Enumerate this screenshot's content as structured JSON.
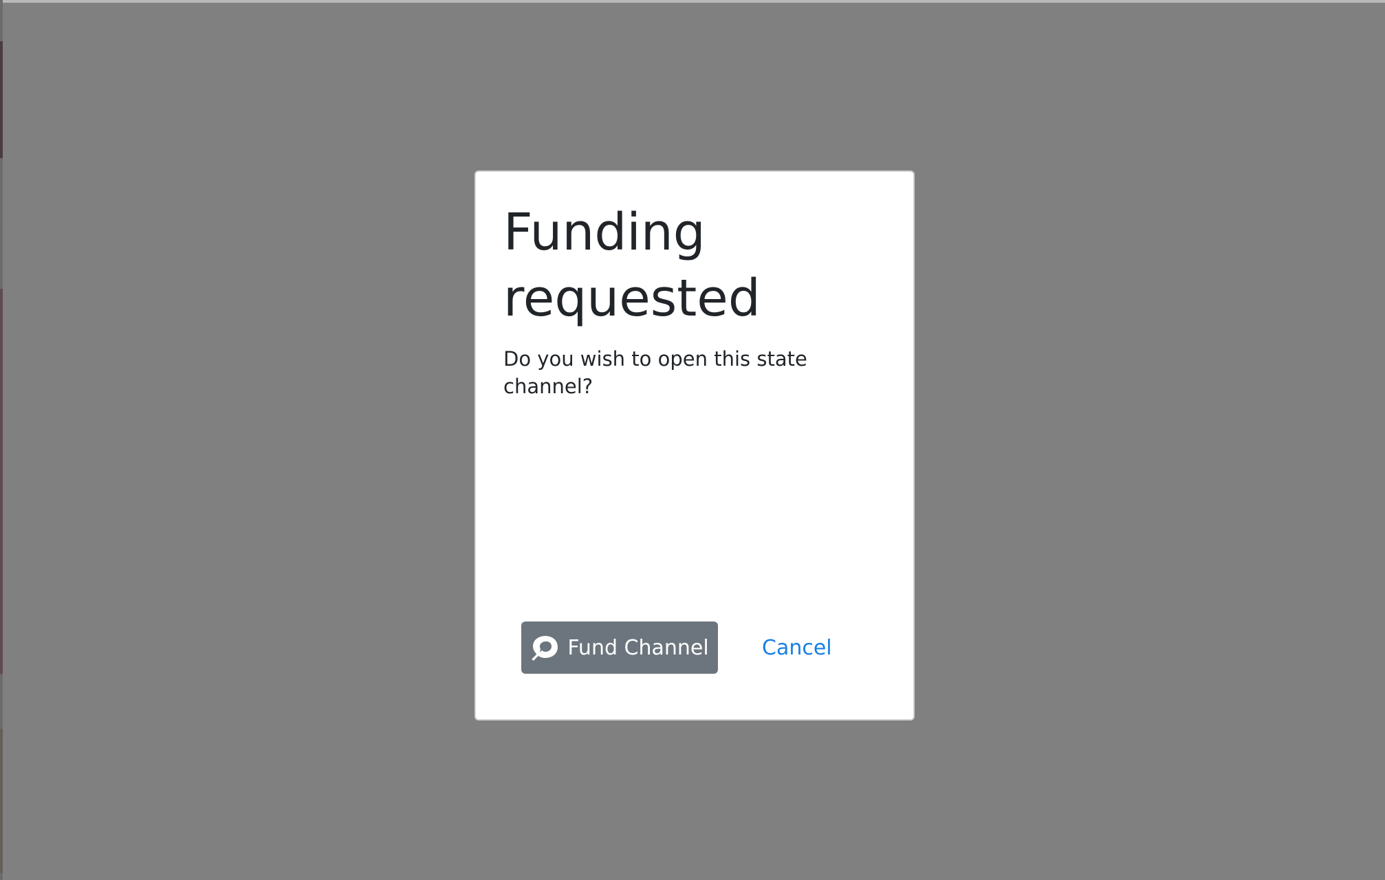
{
  "modal": {
    "title": "Funding requested",
    "message": "Do you wish to open this state channel?",
    "primary_button_label": "Fund Channel",
    "primary_button_icon": "rocket-logo-icon",
    "secondary_button_label": "Cancel"
  },
  "colors": {
    "overlay": "#808080",
    "modal_background": "#ffffff",
    "primary_button": "#6c757d",
    "link": "#1a7fe4",
    "text": "#212529"
  }
}
